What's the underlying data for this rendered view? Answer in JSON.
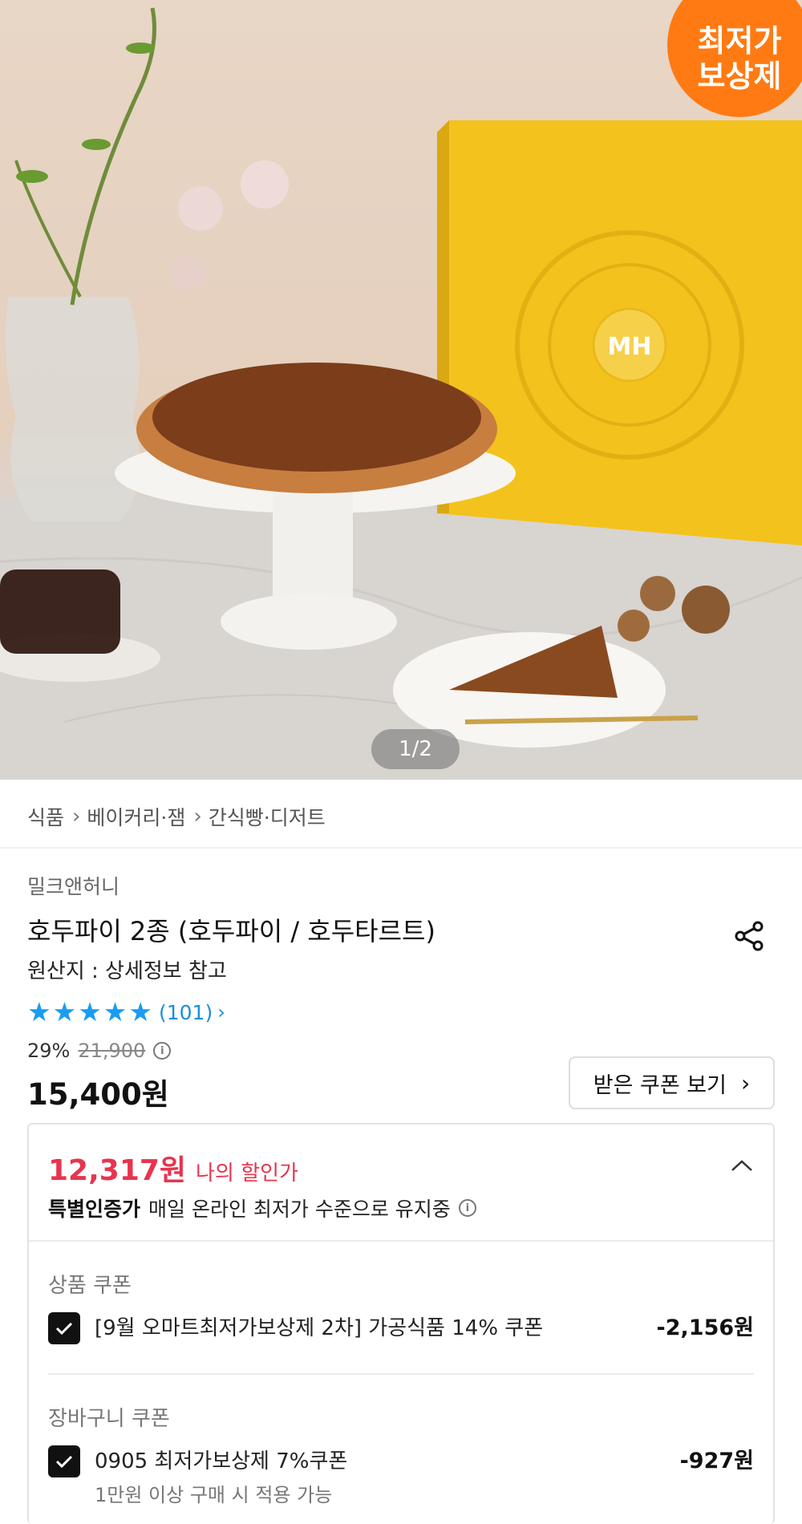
{
  "hero": {
    "badge_line1": "최저가",
    "badge_line2": "보상제",
    "pager": "1/2"
  },
  "breadcrumb": {
    "items": [
      "식품",
      "베이커리·잼",
      "간식빵·디저트"
    ]
  },
  "product": {
    "brand": "밀크앤허니",
    "title": "호두파이 2종 (호두파이 / 호두타르트)",
    "origin": "원산지 : 상세정보 참고",
    "rating": 5,
    "review_count": "(101)",
    "discount_percent": "29%",
    "original_price": "21,900",
    "price": "15,400원",
    "coupon_button": "받은 쿠폰 보기"
  },
  "my_discount": {
    "price": "12,317원",
    "label": "나의 할인가",
    "badge": "특별인증가",
    "note": "매일 온라인 최저가 수준으로 유지중",
    "product_coupon_section": "상품 쿠폰",
    "product_coupon": {
      "name": "[9월 오마트최저가보상제 2차] 가공식품 14% 쿠폰",
      "amount": "-2,156원",
      "checked": true
    },
    "cart_coupon_section": "장바구니 쿠폰",
    "cart_coupon": {
      "name": "0905 최저가보상제 7%쿠폰",
      "condition": "1만원 이상 구매 시 적용 가능",
      "amount": "-927원",
      "checked": true
    }
  },
  "colors": {
    "accent_red": "#e8344e",
    "star_blue": "#1a9cf2",
    "badge_orange": "#ff7a12"
  }
}
